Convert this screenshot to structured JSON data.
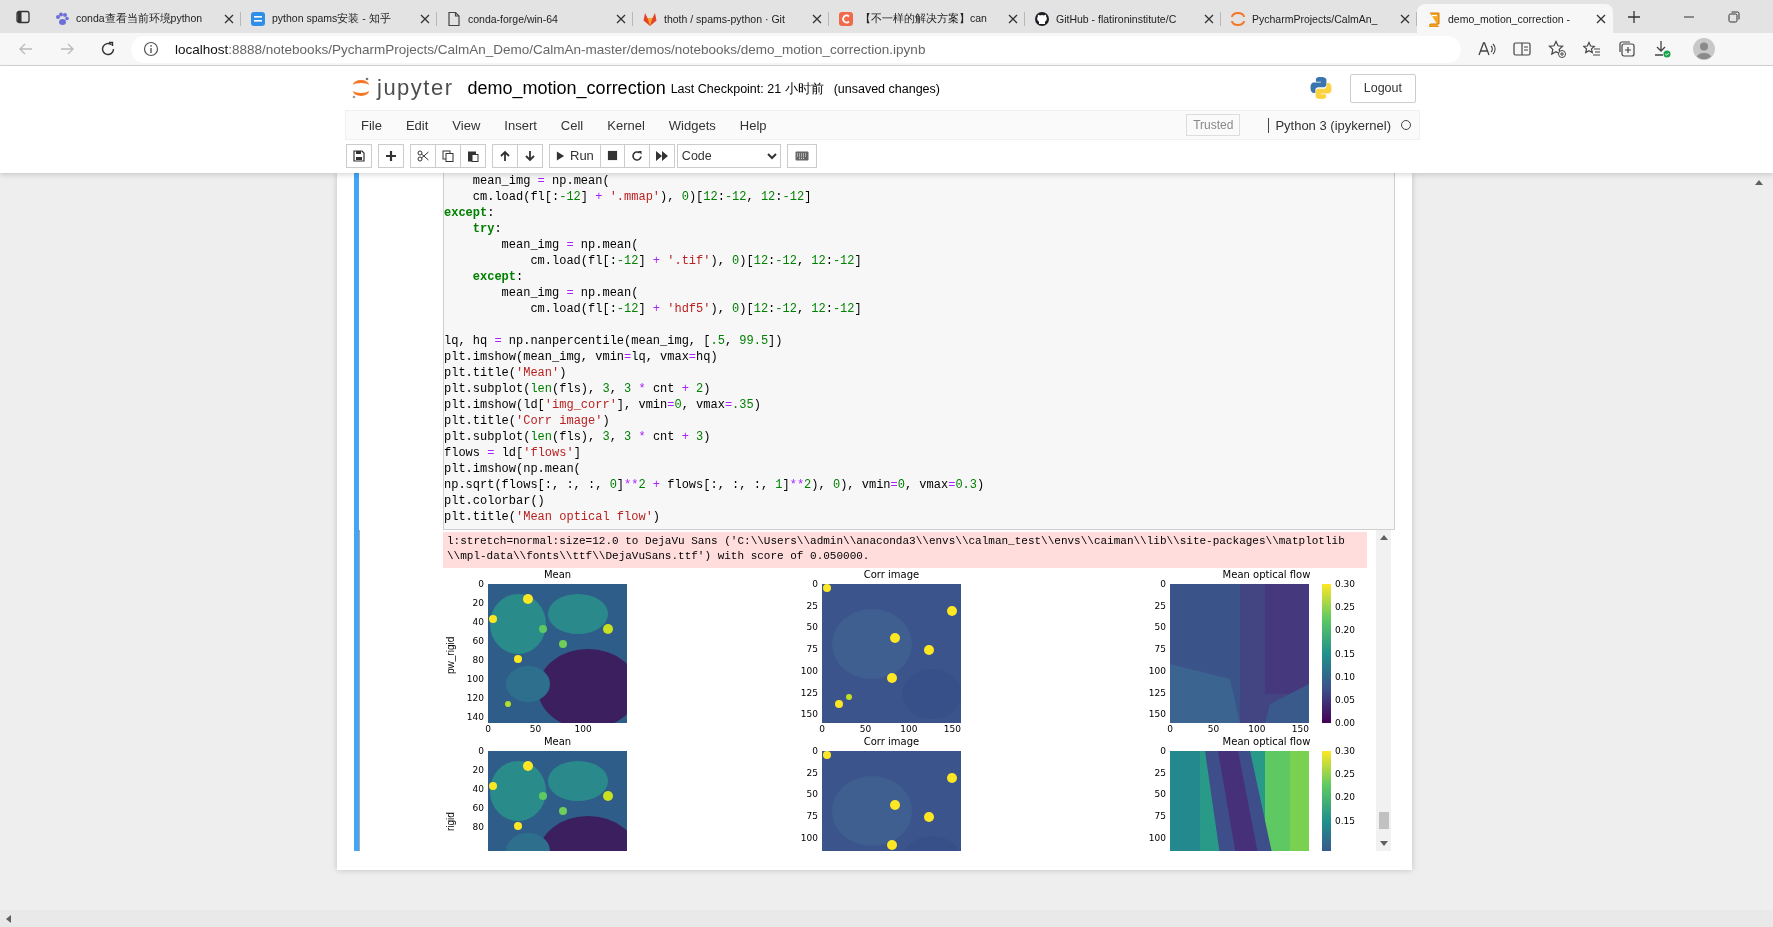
{
  "browser_tabs": [
    {
      "title": "conda查看当前环境python",
      "favicon": {
        "kind": "paw"
      },
      "selected": false
    },
    {
      "title": "python spams安装 - 知乎",
      "favicon": {
        "kind": "tile"
      },
      "selected": false
    },
    {
      "title": "conda-forge/win-64",
      "favicon": {
        "kind": "page"
      },
      "selected": false
    },
    {
      "title": "thoth / spams-python · Git",
      "favicon": {
        "kind": "fox"
      },
      "selected": false
    },
    {
      "title": "【不一样的解决方案】can",
      "favicon": {
        "kind": "red"
      },
      "selected": false
    },
    {
      "title": "GitHub - flatironinstitute/C",
      "favicon": {
        "kind": "cat"
      },
      "selected": false
    },
    {
      "title": "PycharmProjects/CalmAn_",
      "favicon": {
        "kind": "ring"
      },
      "selected": false
    },
    {
      "title": "demo_motion_correction -",
      "favicon": {
        "kind": "book"
      },
      "selected": true
    }
  ],
  "address": {
    "host": "localhost",
    "path": ":8888/notebooks/PycharmProjects/CalmAn_Demo/CalmAn-master/demos/notebooks/demo_motion_correction.ipynb"
  },
  "header": {
    "logo_text": "jupyter",
    "notebook_name": "demo_motion_correction",
    "checkpoint": "Last Checkpoint: 21 小时前",
    "unsaved": "(unsaved changes)",
    "logout": "Logout"
  },
  "menu": [
    "File",
    "Edit",
    "View",
    "Insert",
    "Cell",
    "Kernel",
    "Widgets",
    "Help"
  ],
  "trusted": "Trusted",
  "kernel": {
    "name": "Python 3 (ipykernel)",
    "busy": false
  },
  "toolbar": [
    [
      {
        "kind": "save"
      }
    ],
    [
      {
        "kind": "add"
      }
    ],
    [
      {
        "kind": "cut"
      },
      {
        "kind": "copy"
      },
      {
        "kind": "paste"
      }
    ],
    [
      {
        "kind": "up"
      },
      {
        "kind": "down"
      }
    ],
    [
      {
        "kind": "run",
        "label": "Run"
      },
      {
        "kind": "stop"
      },
      {
        "kind": "restart"
      },
      {
        "kind": "forward"
      }
    ],
    [
      {
        "kind": "select",
        "value": "Code"
      }
    ],
    [
      {
        "kind": "keyboard"
      }
    ]
  ],
  "cell": {
    "selected": true,
    "code_lines": [
      {
        "kind": "code",
        "tokens": [
          {
            "kind": "plain",
            "text": "    mean_img"
          },
          {
            "kind": "op",
            "text": " = "
          },
          {
            "kind": "plain",
            "text": "np.mean("
          }
        ]
      },
      {
        "kind": "code",
        "tokens": [
          {
            "kind": "plain",
            "text": "    cm.load(fl[:"
          },
          {
            "kind": "num",
            "text": "-12"
          },
          {
            "kind": "plain",
            "text": "]"
          },
          {
            "kind": "op",
            "text": " + "
          },
          {
            "kind": "str",
            "text": "'.mmap'"
          },
          {
            "kind": "plain",
            "text": "), "
          },
          {
            "kind": "num",
            "text": "0"
          },
          {
            "kind": "plain",
            "text": ")["
          },
          {
            "kind": "num",
            "text": "12"
          },
          {
            "kind": "plain",
            "text": ":"
          },
          {
            "kind": "num",
            "text": "-12"
          },
          {
            "kind": "plain",
            "text": ", "
          },
          {
            "kind": "num",
            "text": "12"
          },
          {
            "kind": "plain",
            "text": ":"
          },
          {
            "kind": "num",
            "text": "-12"
          },
          {
            "kind": "plain",
            "text": "]"
          }
        ]
      },
      {
        "kind": "code",
        "tokens": [
          {
            "kind": "kw",
            "text": "except"
          },
          {
            "kind": "plain",
            "text": ":"
          }
        ]
      },
      {
        "kind": "code",
        "tokens": [
          {
            "kind": "kw",
            "text": "    try"
          },
          {
            "kind": "plain",
            "text": ":"
          }
        ]
      },
      {
        "kind": "code",
        "tokens": [
          {
            "kind": "plain",
            "text": "        mean_img"
          },
          {
            "kind": "op",
            "text": " = "
          },
          {
            "kind": "plain",
            "text": "np.mean("
          }
        ]
      },
      {
        "kind": "code",
        "tokens": [
          {
            "kind": "plain",
            "text": "            cm.load(fl[:"
          },
          {
            "kind": "num",
            "text": "-12"
          },
          {
            "kind": "plain",
            "text": "]"
          },
          {
            "kind": "op",
            "text": " + "
          },
          {
            "kind": "str",
            "text": "'.tif'"
          },
          {
            "kind": "plain",
            "text": "), "
          },
          {
            "kind": "num",
            "text": "0"
          },
          {
            "kind": "plain",
            "text": ")["
          },
          {
            "kind": "num",
            "text": "12"
          },
          {
            "kind": "plain",
            "text": ":"
          },
          {
            "kind": "num",
            "text": "-12"
          },
          {
            "kind": "plain",
            "text": ", "
          },
          {
            "kind": "num",
            "text": "12"
          },
          {
            "kind": "plain",
            "text": ":"
          },
          {
            "kind": "num",
            "text": "-12"
          },
          {
            "kind": "plain",
            "text": "]"
          }
        ]
      },
      {
        "kind": "code",
        "tokens": [
          {
            "kind": "kw",
            "text": "    except"
          },
          {
            "kind": "plain",
            "text": ":"
          }
        ]
      },
      {
        "kind": "code",
        "tokens": [
          {
            "kind": "plain",
            "text": "        mean_img"
          },
          {
            "kind": "op",
            "text": " = "
          },
          {
            "kind": "plain",
            "text": "np.mean("
          }
        ]
      },
      {
        "kind": "code",
        "tokens": [
          {
            "kind": "plain",
            "text": "            cm.load(fl[:"
          },
          {
            "kind": "num",
            "text": "-12"
          },
          {
            "kind": "plain",
            "text": "]"
          },
          {
            "kind": "op",
            "text": " + "
          },
          {
            "kind": "str",
            "text": "'hdf5'"
          },
          {
            "kind": "plain",
            "text": "), "
          },
          {
            "kind": "num",
            "text": "0"
          },
          {
            "kind": "plain",
            "text": ")["
          },
          {
            "kind": "num",
            "text": "12"
          },
          {
            "kind": "plain",
            "text": ":"
          },
          {
            "kind": "num",
            "text": "-12"
          },
          {
            "kind": "plain",
            "text": ", "
          },
          {
            "kind": "num",
            "text": "12"
          },
          {
            "kind": "plain",
            "text": ":"
          },
          {
            "kind": "num",
            "text": "-12"
          },
          {
            "kind": "plain",
            "text": "]"
          }
        ]
      },
      {
        "kind": "blank"
      },
      {
        "kind": "code",
        "tokens": [
          {
            "kind": "plain",
            "text": "lq, hq"
          },
          {
            "kind": "op",
            "text": " = "
          },
          {
            "kind": "plain",
            "text": "np.nanpercentile(mean_img, ["
          },
          {
            "kind": "num",
            "text": ".5"
          },
          {
            "kind": "plain",
            "text": ", "
          },
          {
            "kind": "num",
            "text": "99.5"
          },
          {
            "kind": "plain",
            "text": "])"
          }
        ]
      },
      {
        "kind": "code",
        "tokens": [
          {
            "kind": "plain",
            "text": "plt.imshow(mean_img, vmin"
          },
          {
            "kind": "op",
            "text": "="
          },
          {
            "kind": "plain",
            "text": "lq, vmax"
          },
          {
            "kind": "op",
            "text": "="
          },
          {
            "kind": "plain",
            "text": "hq)"
          }
        ]
      },
      {
        "kind": "code",
        "tokens": [
          {
            "kind": "plain",
            "text": "plt.title("
          },
          {
            "kind": "str",
            "text": "'Mean'"
          },
          {
            "kind": "plain",
            "text": ")"
          }
        ]
      },
      {
        "kind": "code",
        "tokens": [
          {
            "kind": "plain",
            "text": "plt.subplot("
          },
          {
            "kind": "builtin",
            "text": "len"
          },
          {
            "kind": "plain",
            "text": "(fls), "
          },
          {
            "kind": "num",
            "text": "3"
          },
          {
            "kind": "plain",
            "text": ", "
          },
          {
            "kind": "num",
            "text": "3"
          },
          {
            "kind": "op",
            "text": " * "
          },
          {
            "kind": "plain",
            "text": "cnt"
          },
          {
            "kind": "op",
            "text": " + "
          },
          {
            "kind": "num",
            "text": "2"
          },
          {
            "kind": "plain",
            "text": ")"
          }
        ]
      },
      {
        "kind": "code",
        "tokens": [
          {
            "kind": "plain",
            "text": "plt.imshow(ld["
          },
          {
            "kind": "str",
            "text": "'img_corr'"
          },
          {
            "kind": "plain",
            "text": "], vmin"
          },
          {
            "kind": "op",
            "text": "="
          },
          {
            "kind": "num",
            "text": "0"
          },
          {
            "kind": "plain",
            "text": ", vmax"
          },
          {
            "kind": "op",
            "text": "="
          },
          {
            "kind": "num",
            "text": ".35"
          },
          {
            "kind": "plain",
            "text": ")"
          }
        ]
      },
      {
        "kind": "code",
        "tokens": [
          {
            "kind": "plain",
            "text": "plt.title("
          },
          {
            "kind": "str",
            "text": "'Corr image'"
          },
          {
            "kind": "plain",
            "text": ")"
          }
        ]
      },
      {
        "kind": "code",
        "tokens": [
          {
            "kind": "plain",
            "text": "plt.subplot("
          },
          {
            "kind": "builtin",
            "text": "len"
          },
          {
            "kind": "plain",
            "text": "(fls), "
          },
          {
            "kind": "num",
            "text": "3"
          },
          {
            "kind": "plain",
            "text": ", "
          },
          {
            "kind": "num",
            "text": "3"
          },
          {
            "kind": "op",
            "text": " * "
          },
          {
            "kind": "plain",
            "text": "cnt"
          },
          {
            "kind": "op",
            "text": " + "
          },
          {
            "kind": "num",
            "text": "3"
          },
          {
            "kind": "plain",
            "text": ")"
          }
        ]
      },
      {
        "kind": "code",
        "tokens": [
          {
            "kind": "plain",
            "text": "flows"
          },
          {
            "kind": "op",
            "text": " = "
          },
          {
            "kind": "plain",
            "text": "ld["
          },
          {
            "kind": "str",
            "text": "'flows'"
          },
          {
            "kind": "plain",
            "text": "]"
          }
        ]
      },
      {
        "kind": "code",
        "tokens": [
          {
            "kind": "plain",
            "text": "plt.imshow(np.mean("
          }
        ]
      },
      {
        "kind": "code",
        "tokens": [
          {
            "kind": "plain",
            "text": "np.sqrt(flows[:, :, :, "
          },
          {
            "kind": "num",
            "text": "0"
          },
          {
            "kind": "plain",
            "text": "]"
          },
          {
            "kind": "op",
            "text": "**"
          },
          {
            "kind": "num",
            "text": "2"
          },
          {
            "kind": "op",
            "text": " + "
          },
          {
            "kind": "plain",
            "text": "flows[:, :, :, "
          },
          {
            "kind": "num",
            "text": "1"
          },
          {
            "kind": "plain",
            "text": "]"
          },
          {
            "kind": "op",
            "text": "**"
          },
          {
            "kind": "num",
            "text": "2"
          },
          {
            "kind": "plain",
            "text": "), "
          },
          {
            "kind": "num",
            "text": "0"
          },
          {
            "kind": "plain",
            "text": "), vmin"
          },
          {
            "kind": "op",
            "text": "="
          },
          {
            "kind": "num",
            "text": "0"
          },
          {
            "kind": "plain",
            "text": ", vmax"
          },
          {
            "kind": "op",
            "text": "="
          },
          {
            "kind": "num",
            "text": "0.3"
          },
          {
            "kind": "plain",
            "text": ")"
          }
        ]
      },
      {
        "kind": "code",
        "tokens": [
          {
            "kind": "plain",
            "text": "plt.colorbar()"
          }
        ]
      },
      {
        "kind": "code",
        "tokens": [
          {
            "kind": "plain",
            "text": "plt.title("
          },
          {
            "kind": "str",
            "text": "'Mean optical flow'"
          },
          {
            "kind": "plain",
            "text": ")"
          }
        ]
      }
    ],
    "stderr_lines": [
      "l:stretch=normal:size=12.0 to DejaVu Sans ('C:\\\\Users\\\\admin\\\\anaconda3\\\\envs\\\\calman_test\\\\envs\\\\caiman\\\\lib\\\\site-packages\\\\matplotlib",
      "\\\\mpl-data\\\\fonts\\\\ttf\\\\DejaVuSans.ttf') with score of 0.050000."
    ],
    "plot_rows": [
      {
        "ylabel": "pw_rigid",
        "plots": [
          {
            "title": "Mean",
            "yticks": [
              "0",
              "20",
              "40",
              "60",
              "80",
              "100",
              "120",
              "140"
            ],
            "xticks": [
              "0",
              "50",
              "100"
            ]
          },
          {
            "title": "Corr image",
            "yticks": [
              "0",
              "25",
              "50",
              "75",
              "100",
              "125",
              "150"
            ],
            "xticks": [
              "0",
              "50",
              "100",
              "150"
            ]
          },
          {
            "title": "Mean optical flow",
            "yticks": [
              "0",
              "25",
              "50",
              "75",
              "100",
              "125",
              "150"
            ],
            "xticks": [
              "0",
              "50",
              "100",
              "150"
            ],
            "colorbar_ticks": [
              "0.30",
              "0.25",
              "0.20",
              "0.15",
              "0.10",
              "0.05",
              "0.00"
            ]
          }
        ]
      },
      {
        "ylabel": "rigid",
        "plots": [
          {
            "title": "Mean",
            "yticks": [
              "0",
              "20",
              "40",
              "60",
              "80"
            ]
          },
          {
            "title": "Corr image",
            "yticks": [
              "0",
              "25",
              "50",
              "75",
              "100"
            ]
          },
          {
            "title": "Mean optical flow",
            "yticks": [
              "0",
              "25",
              "50",
              "75",
              "100"
            ],
            "colorbar_ticks": [
              "0.30",
              "0.25",
              "0.20",
              "0.15"
            ]
          }
        ]
      }
    ]
  }
}
